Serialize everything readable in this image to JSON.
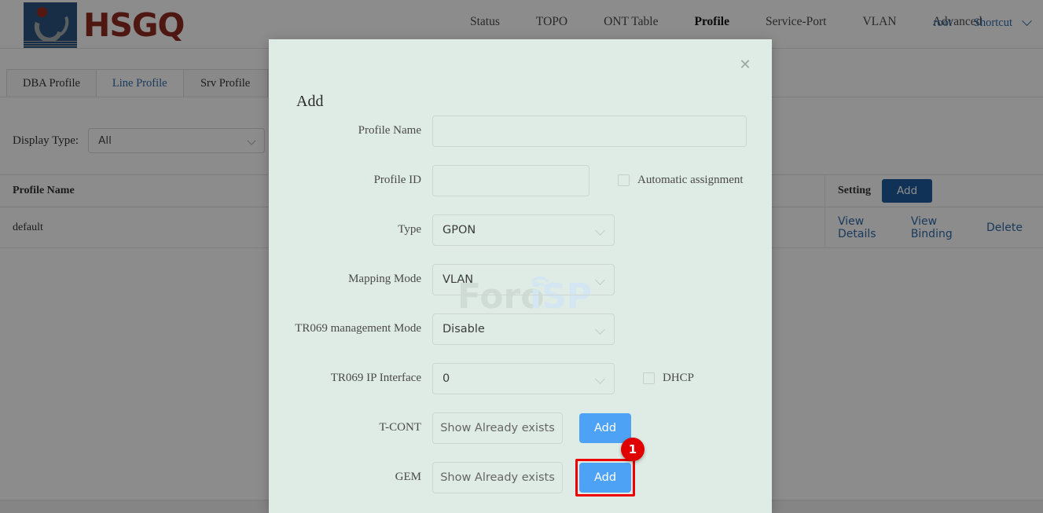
{
  "header": {
    "logo_text": "HSGQ",
    "nav_items": [
      {
        "label": "Status",
        "active": false
      },
      {
        "label": "TOPO",
        "active": false
      },
      {
        "label": "ONT Table",
        "active": false
      },
      {
        "label": "Profile",
        "active": true
      },
      {
        "label": "Service-Port",
        "active": false
      },
      {
        "label": "VLAN",
        "active": false
      },
      {
        "label": "Advanced",
        "active": false
      }
    ],
    "user": "root",
    "shortcut": "Shortcut"
  },
  "tabs": [
    {
      "label": "DBA Profile",
      "active": false
    },
    {
      "label": "Line Profile",
      "active": true
    },
    {
      "label": "Srv Profile",
      "active": false
    },
    {
      "label": "",
      "active": false
    }
  ],
  "filter": {
    "label": "Display Type:",
    "value": "All"
  },
  "table": {
    "columns": [
      "Profile Name",
      "Setting"
    ],
    "header_add_label": "Add",
    "rows": [
      {
        "profile_name": "default",
        "actions": [
          "View Details",
          "View Binding",
          "Delete"
        ]
      }
    ]
  },
  "modal": {
    "title": "Add",
    "close_icon": "close-icon",
    "watermark": {
      "part1": "Foro",
      "part2": "iSP"
    },
    "fields": {
      "profile_name": {
        "label": "Profile Name",
        "value": "",
        "placeholder": ""
      },
      "profile_id": {
        "label": "Profile ID",
        "value": "",
        "placeholder": ""
      },
      "automatic_assignment": {
        "label": "Automatic assignment",
        "checked": false
      },
      "type": {
        "label": "Type",
        "value": "GPON"
      },
      "mapping_mode": {
        "label": "Mapping Mode",
        "value": "VLAN"
      },
      "tr069_management_mode": {
        "label": "TR069 management Mode",
        "value": "Disable"
      },
      "tr069_ip_interface": {
        "label": "TR069 IP Interface",
        "value": "0"
      },
      "dhcp": {
        "label": "DHCP",
        "checked": false
      },
      "tcont": {
        "label": "T-CONT",
        "show_label": "Show Already exists",
        "add_label": "Add"
      },
      "gem": {
        "label": "GEM",
        "show_label": "Show Already exists",
        "add_label": "Add"
      }
    },
    "annotation_badge": "1"
  },
  "colors": {
    "accent_blue": "#4da2f5",
    "link_blue": "#2f6aa8",
    "brand_red": "#8e2a20",
    "brand_navy": "#2b5580",
    "modal_bg": "#dfece5",
    "highlight_red": "#ee0000"
  }
}
